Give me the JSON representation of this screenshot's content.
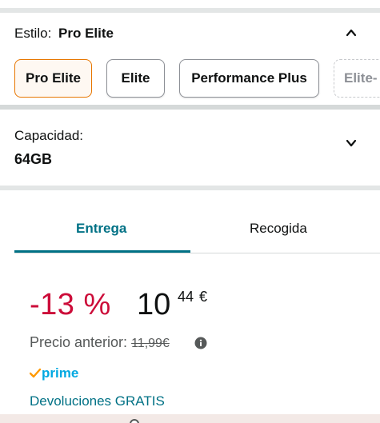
{
  "style": {
    "label": "Estilo:",
    "selected_value": "Pro Elite",
    "options": [
      "Pro Elite",
      "Elite",
      "Performance Plus",
      "Elite-"
    ]
  },
  "capacity": {
    "label": "Capacidad:",
    "value": "64GB"
  },
  "tabs": {
    "delivery": "Entrega",
    "pickup": "Recogida"
  },
  "price": {
    "discount": "-13 %",
    "whole": "10",
    "fraction": "44",
    "currency": "€",
    "previous_label": "Precio anterior:",
    "previous_value": "11,99€"
  },
  "prime_label": "prime",
  "returns_label": "Devoluciones GRATIS",
  "colors": {
    "accent_teal": "#007185",
    "discount_red": "#cc0c39",
    "selected_border": "#e77600",
    "prime_blue": "#00a8e1",
    "prime_check": "#ff9900"
  }
}
